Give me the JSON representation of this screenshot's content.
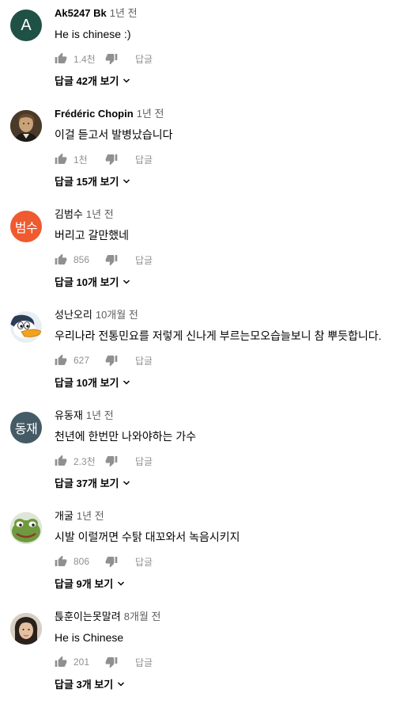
{
  "comments": [
    {
      "author": "Ak5247 Bk",
      "author_bold": true,
      "time": "1년 전",
      "text": "He is chinese :)",
      "likes": "1.4천",
      "reply_label": "답글",
      "replies_label": "답글 42개 보기",
      "avatar": {
        "type": "letter",
        "text": "A",
        "color": "#1f5145"
      }
    },
    {
      "author": "Frédéric Chopin",
      "author_bold": true,
      "time": "1년 전",
      "text": "이걸 듣고서 발병났습니다",
      "likes": "1천",
      "reply_label": "답글",
      "replies_label": "답글 15개 보기",
      "avatar": {
        "type": "portrait-chopin"
      }
    },
    {
      "author": "김범수",
      "author_bold": false,
      "time": "1년 전",
      "text": "버리고 갈만했네",
      "likes": "856",
      "reply_label": "답글",
      "replies_label": "답글 10개 보기",
      "avatar": {
        "type": "letter",
        "text": "범수",
        "color": "#ef5a2f"
      }
    },
    {
      "author": "성난오리",
      "author_bold": false,
      "time": "10개월 전",
      "text": "우리나라 전통민요를 저렇게 신나게 부르는모오습늘보니 참 뿌듯합니다.",
      "likes": "627",
      "reply_label": "답글",
      "replies_label": "답글 10개 보기",
      "avatar": {
        "type": "duck"
      }
    },
    {
      "author": "유동재",
      "author_bold": false,
      "time": "1년 전",
      "text": "천년에 한번만 나와야하는 가수",
      "likes": "2.3천",
      "reply_label": "답글",
      "replies_label": "답글 37개 보기",
      "avatar": {
        "type": "letter",
        "text": "동재",
        "color": "#445b66"
      }
    },
    {
      "author": "개굴",
      "author_bold": false,
      "time": "1년 전",
      "text": "시발 이럴꺼면 수탉 대꼬와서 녹음시키지",
      "likes": "806",
      "reply_label": "답글",
      "replies_label": "답글 9개 보기",
      "avatar": {
        "type": "frog"
      }
    },
    {
      "author": "튽훈이는못말려",
      "author_bold": false,
      "time": "8개월 전",
      "text": "He is Chinese",
      "likes": "201",
      "reply_label": "답글",
      "replies_label": "답글 3개 보기",
      "avatar": {
        "type": "photo-person"
      }
    }
  ],
  "icons": {
    "like": "thumb-up-icon",
    "dislike": "thumb-down-icon",
    "expand": "chevron-down-icon"
  },
  "colors": {
    "text_primary": "#030303",
    "text_secondary": "#606060",
    "icon_gray": "#909090"
  }
}
